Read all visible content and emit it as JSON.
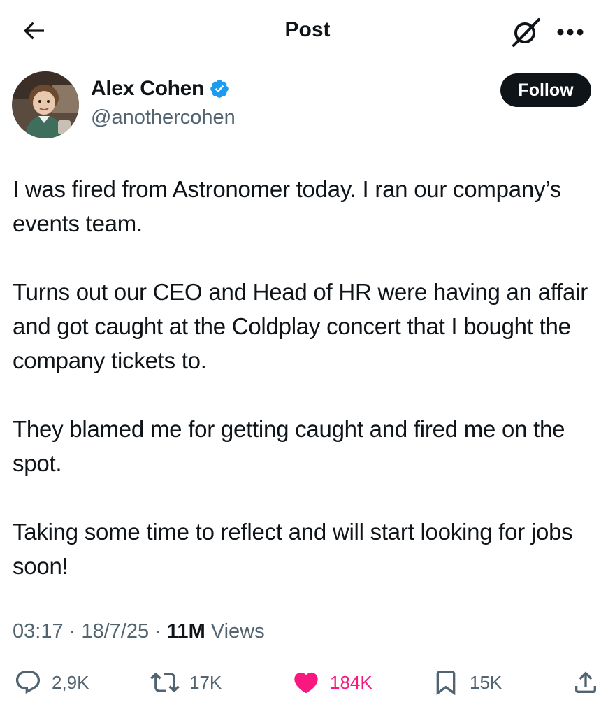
{
  "header": {
    "title": "Post",
    "back_icon": "arrow-left-icon",
    "grok_icon": "grok-icon",
    "more_icon": "more-horizontal-icon"
  },
  "author": {
    "name": "Alex Cohen",
    "handle": "@anothercohen",
    "verified": true,
    "verified_color": "#1d9bf0",
    "follow_label": "Follow"
  },
  "post": {
    "paragraphs": [
      "I was fired from Astronomer today. I ran our company’s events team.",
      "Turns out our CEO and Head of HR were having an affair and got caught at the Coldplay concert that I bought the company tickets to.",
      "They blamed me for getting caught and fired me on the spot.",
      "Taking some time to reflect and will start looking for jobs soon!"
    ],
    "time": "03:17",
    "date": "18/7/25",
    "sep": " · ",
    "views_count": "11M",
    "views_label": " Views"
  },
  "actions": {
    "replies": "2,9K",
    "reposts": "17K",
    "likes": "184K",
    "bookmarks": "15K",
    "like_color": "#f91880",
    "muted_color": "#536471"
  }
}
